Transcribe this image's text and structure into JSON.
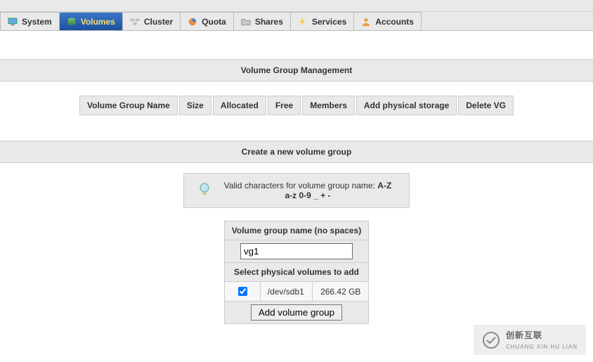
{
  "menu": {
    "system": "System",
    "volumes": "Volumes",
    "cluster": "Cluster",
    "quota": "Quota",
    "shares": "Shares",
    "services": "Services",
    "accounts": "Accounts"
  },
  "vg_mgmt": {
    "title": "Volume Group Management",
    "headers": {
      "name": "Volume Group Name",
      "size": "Size",
      "allocated": "Allocated",
      "free": "Free",
      "members": "Members",
      "add": "Add physical storage",
      "delete": "Delete VG"
    }
  },
  "create": {
    "title": "Create a new volume group",
    "hint_label": "Valid characters for volume group name: ",
    "hint_chars": "A-Z a-z 0-9 _ + -",
    "name_label": "Volume group name (no spaces)",
    "name_value": "vg1",
    "pv_label": "Select physical volumes to add",
    "pv_rows": [
      {
        "checked": true,
        "dev": "/dev/sdb1",
        "size": "266.42 GB"
      }
    ],
    "add_btn": "Add volume group"
  },
  "watermark": {
    "brand": "创新互联",
    "sub": "CHUANG XIN HU LIAN"
  }
}
